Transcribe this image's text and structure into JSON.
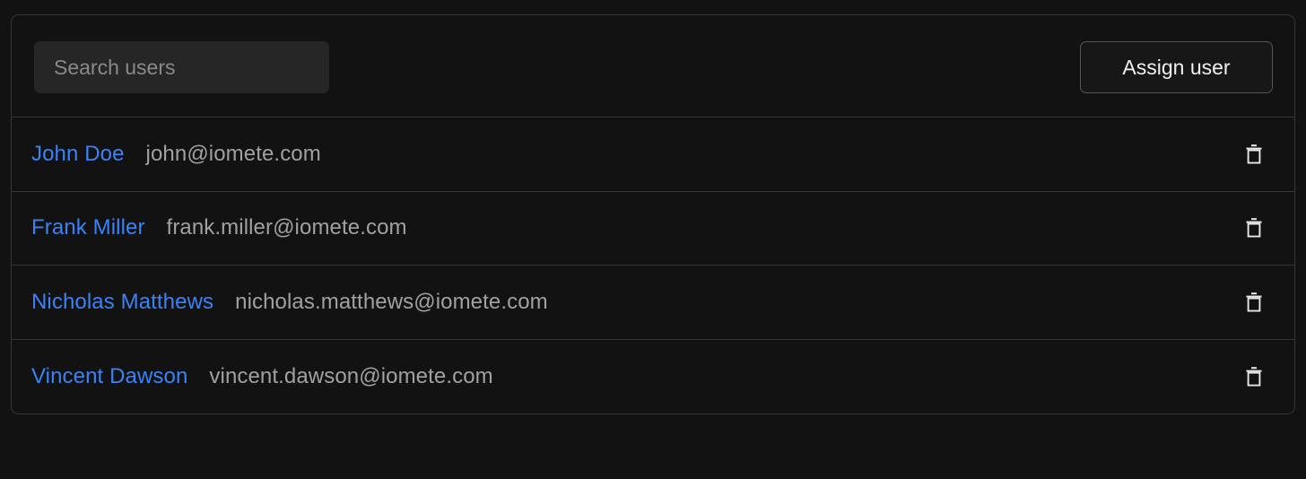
{
  "theme": {
    "page_background": "#121212",
    "card_background": "#121212",
    "border_color": "#333537",
    "link_color": "#3b82f6",
    "email_color": "#a1a1a1",
    "search_field_background": "#262626",
    "placeholder_color": "#8a8a8a",
    "button_text_color": "#f0f0f0",
    "button_border_color": "#565656",
    "icon_color": "#e8e8e8"
  },
  "toolbar": {
    "search": {
      "placeholder": "Search users",
      "value": "",
      "icon": "search-icon"
    },
    "assign_user_label": "Assign user"
  },
  "users": {
    "delete_icon": "trash-icon",
    "rows": [
      {
        "name": "John Doe",
        "email": "john@iomete.com"
      },
      {
        "name": "Frank Miller",
        "email": "frank.miller@iomete.com"
      },
      {
        "name": "Nicholas Matthews",
        "email": "nicholas.matthews@iomete.com"
      },
      {
        "name": "Vincent Dawson",
        "email": "vincent.dawson@iomete.com"
      }
    ]
  }
}
